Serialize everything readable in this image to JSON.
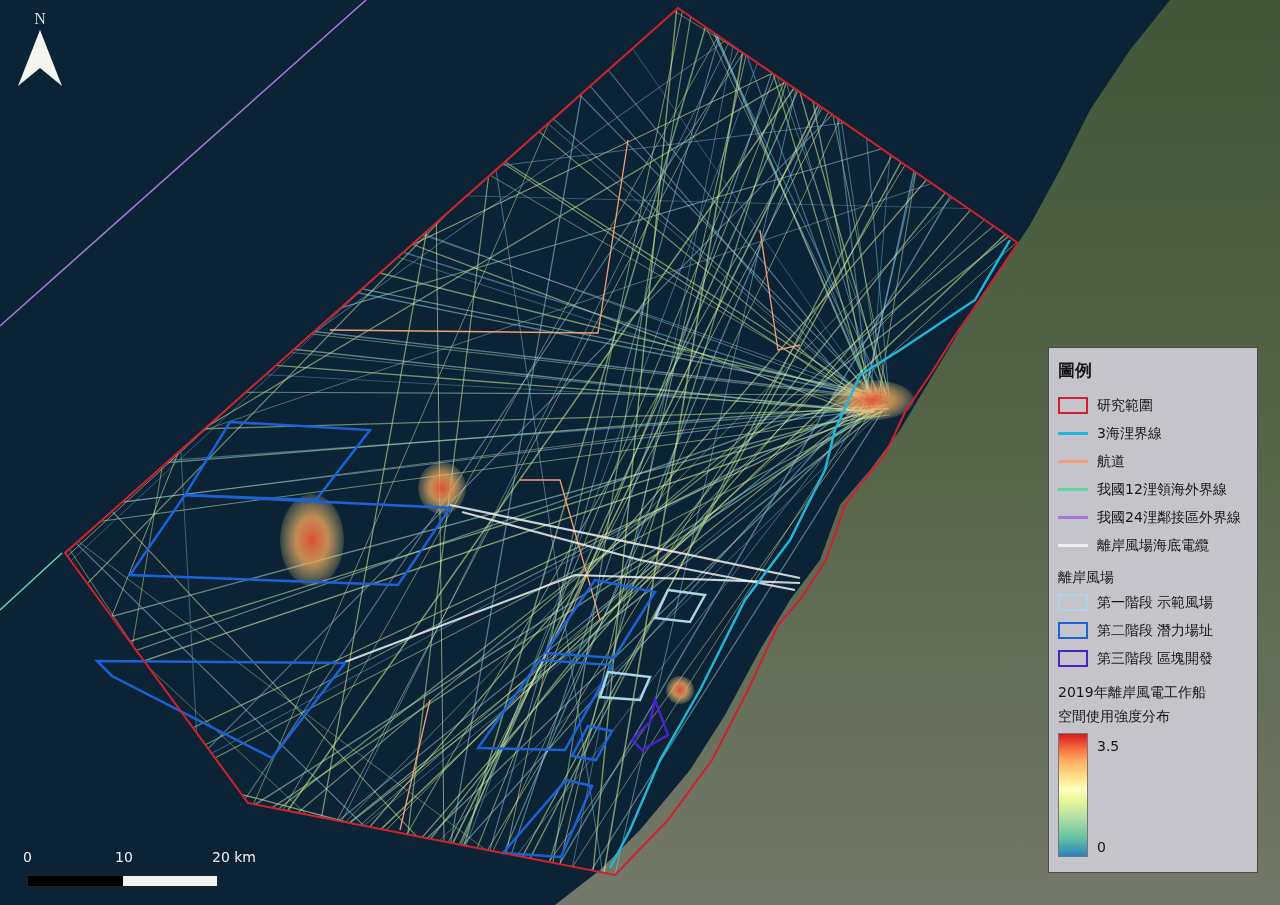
{
  "north_arrow": {
    "label": "N"
  },
  "scale_bar": {
    "ticks": [
      "0",
      "10",
      "20 km"
    ]
  },
  "legend": {
    "title": "圖例",
    "items": [
      {
        "kind": "box",
        "label": "研究範圍",
        "color": "#d0202e"
      },
      {
        "kind": "line",
        "label": "3海浬界線",
        "color": "#1fb8d8"
      },
      {
        "kind": "line",
        "label": "航道",
        "color": "#f0a07a"
      },
      {
        "kind": "line",
        "label": "我國12浬領海外界線",
        "color": "#5fd6a0"
      },
      {
        "kind": "line",
        "label": "我國24浬鄰接區外界線",
        "color": "#a47ad8"
      },
      {
        "kind": "line",
        "label": "離岸風場海底電纜",
        "color": "#eef0ee"
      }
    ],
    "wind_farm_title": "離岸風場",
    "wind_farms": [
      {
        "label": "第一階段 示範風場",
        "color": "#a9d5e6"
      },
      {
        "label": "第二階段 潛力場址",
        "color": "#1a62d6"
      },
      {
        "label": "第三階段 區塊開發",
        "color": "#4a22c8"
      }
    ],
    "intensity": {
      "title_lines": [
        "2019年離岸風電工作船",
        "空間使用強度分布"
      ],
      "max_label": "3.5",
      "min_label": "0"
    }
  }
}
